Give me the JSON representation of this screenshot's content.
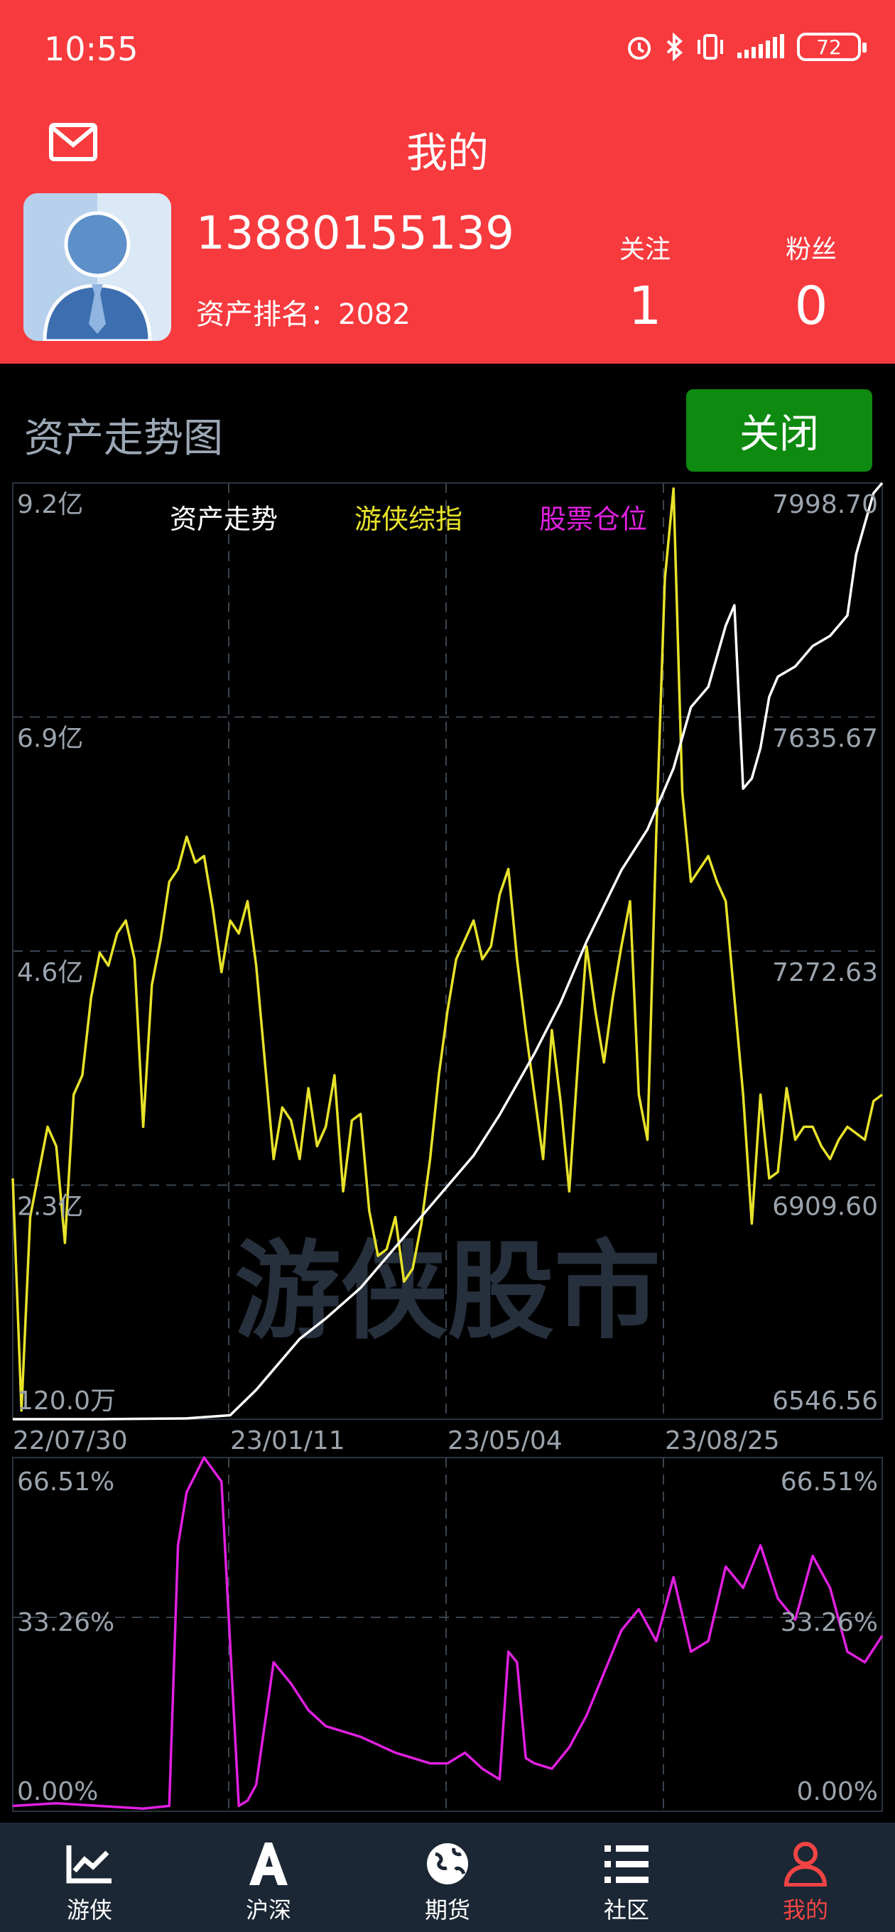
{
  "status_bar": {
    "time": "10:55",
    "battery": "72"
  },
  "header": {
    "title": "我的"
  },
  "profile": {
    "phone": "13880155139",
    "rank_label": "资产排名：",
    "rank_value": "2082",
    "following_label": "关注",
    "following_value": "1",
    "followers_label": "粉丝",
    "followers_value": "0"
  },
  "panel": {
    "title": "资产走势图",
    "close_label": "关闭",
    "watermark": "游侠股市"
  },
  "colors": {
    "header_red": "#f73a3e",
    "asset_line": "#ffffff",
    "index_line": "#e8e22a",
    "position_line": "#e020e0",
    "close_green": "#0d8a0f",
    "nav_bg": "#1c2735",
    "nav_active": "#f24444"
  },
  "chart_data": [
    {
      "type": "line",
      "legend": [
        "资产走势",
        "游侠综指",
        "股票仓位"
      ],
      "x_tick_labels": [
        "22/07/30",
        "23/01/11",
        "23/05/04",
        "23/08/25"
      ],
      "left_axis_labels": [
        "9.2亿",
        "6.9亿",
        "4.6亿",
        "2.3亿",
        "120.0万"
      ],
      "right_axis_labels": [
        "7998.70",
        "7635.67",
        "7272.63",
        "6909.60",
        "6546.56"
      ],
      "left_ylim": [
        1200000,
        920000000
      ],
      "right_ylim": [
        6546.56,
        7998.7
      ],
      "series": [
        {
          "name": "资产走势",
          "axis": "left",
          "x": [
            0,
            0.1,
            0.2,
            0.25,
            0.28,
            0.3,
            0.33,
            0.36,
            0.4,
            0.43,
            0.46,
            0.5,
            0.53,
            0.56,
            0.6,
            0.63,
            0.66,
            0.7,
            0.73,
            0.76,
            0.78,
            0.8,
            0.82,
            0.83,
            0.84,
            0.85,
            0.86,
            0.87,
            0.88,
            0.9,
            0.92,
            0.94,
            0.96,
            0.97,
            0.98,
            0.99,
            1
          ],
          "y": [
            1200000,
            1200000,
            2000000,
            5000000,
            30000000,
            50000000,
            80000000,
            100000000,
            130000000,
            160000000,
            190000000,
            230000000,
            260000000,
            300000000,
            360000000,
            410000000,
            470000000,
            540000000,
            580000000,
            640000000,
            700000000,
            720000000,
            780000000,
            800000000,
            620000000,
            630000000,
            660000000,
            710000000,
            730000000,
            740000000,
            760000000,
            770000000,
            790000000,
            850000000,
            880000000,
            910000000,
            920000000
          ]
        },
        {
          "name": "游侠综指",
          "axis": "right",
          "x": [
            0,
            0.01,
            0.02,
            0.03,
            0.04,
            0.05,
            0.06,
            0.07,
            0.08,
            0.09,
            0.1,
            0.11,
            0.12,
            0.13,
            0.14,
            0.15,
            0.16,
            0.17,
            0.18,
            0.19,
            0.2,
            0.21,
            0.22,
            0.23,
            0.24,
            0.25,
            0.26,
            0.27,
            0.28,
            0.29,
            0.3,
            0.31,
            0.32,
            0.33,
            0.34,
            0.35,
            0.36,
            0.37,
            0.38,
            0.39,
            0.4,
            0.41,
            0.42,
            0.43,
            0.44,
            0.45,
            0.46,
            0.47,
            0.48,
            0.49,
            0.5,
            0.51,
            0.52,
            0.53,
            0.54,
            0.55,
            0.56,
            0.57,
            0.58,
            0.59,
            0.6,
            0.61,
            0.62,
            0.63,
            0.64,
            0.65,
            0.66,
            0.67,
            0.68,
            0.69,
            0.7,
            0.71,
            0.72,
            0.73,
            0.74,
            0.75,
            0.76,
            0.77,
            0.78,
            0.79,
            0.8,
            0.81,
            0.82,
            0.83,
            0.84,
            0.85,
            0.86,
            0.87,
            0.88,
            0.89,
            0.9,
            0.91,
            0.92,
            0.93,
            0.94,
            0.95,
            0.96,
            0.97,
            0.98,
            0.99,
            1
          ],
          "y": [
            6920,
            6560,
            6860,
            6930,
            7000,
            6970,
            6820,
            7050,
            7080,
            7200,
            7270,
            7250,
            7300,
            7320,
            7260,
            7000,
            7220,
            7290,
            7380,
            7400,
            7450,
            7410,
            7420,
            7340,
            7240,
            7320,
            7300,
            7350,
            7250,
            7100,
            6950,
            7030,
            7010,
            6950,
            7060,
            6970,
            7000,
            7080,
            6900,
            7010,
            7020,
            6870,
            6800,
            6810,
            6860,
            6760,
            6780,
            6850,
            6950,
            7080,
            7180,
            7260,
            7290,
            7320,
            7260,
            7280,
            7360,
            7400,
            7260,
            7150,
            7050,
            6950,
            7150,
            7040,
            6900,
            7100,
            7280,
            7180,
            7100,
            7200,
            7280,
            7350,
            7050,
            6980,
            7450,
            7850,
            7990,
            7520,
            7380,
            7400,
            7420,
            7380,
            7350,
            7200,
            7050,
            6850,
            7050,
            6920,
            6930,
            7060,
            6980,
            7000,
            7000,
            6970,
            6950,
            6980,
            7000,
            6990,
            6980,
            7040,
            7050
          ]
        },
        {
          "name": "股票仓位",
          "axis": "bottom",
          "x": [
            0,
            0.05,
            0.1,
            0.15,
            0.18,
            0.19,
            0.2,
            0.22,
            0.24,
            0.26,
            0.27,
            0.28,
            0.3,
            0.32,
            0.34,
            0.36,
            0.4,
            0.44,
            0.48,
            0.5,
            0.52,
            0.54,
            0.56,
            0.57,
            0.58,
            0.59,
            0.6,
            0.62,
            0.64,
            0.66,
            0.68,
            0.7,
            0.72,
            0.74,
            0.76,
            0.78,
            0.8,
            0.82,
            0.84,
            0.86,
            0.88,
            0.9,
            0.92,
            0.94,
            0.96,
            0.98,
            1
          ],
          "y": [
            1.0,
            1.5,
            1.0,
            0.5,
            1.0,
            50,
            60,
            66.51,
            62,
            1.0,
            2.0,
            5.0,
            28,
            24,
            19,
            16,
            14,
            11,
            9,
            9,
            11,
            8,
            6,
            30,
            28,
            10,
            9,
            8,
            12,
            18,
            26,
            34,
            38,
            32,
            44,
            30,
            32,
            46,
            42,
            50,
            40,
            36,
            48,
            42,
            30,
            28,
            33
          ]
        }
      ],
      "bottom_axis_labels": [
        "66.51%",
        "33.26%",
        "0.00%"
      ],
      "bottom_ylim": [
        0,
        66.51
      ],
      "grid": true
    }
  ],
  "nav": [
    {
      "label": "游侠",
      "icon": "chart-icon",
      "active": false
    },
    {
      "label": "沪深",
      "icon": "letter-a-icon",
      "active": false
    },
    {
      "label": "期货",
      "icon": "globe-icon",
      "active": false
    },
    {
      "label": "社区",
      "icon": "list-icon",
      "active": false
    },
    {
      "label": "我的",
      "icon": "person-icon",
      "active": true
    }
  ]
}
